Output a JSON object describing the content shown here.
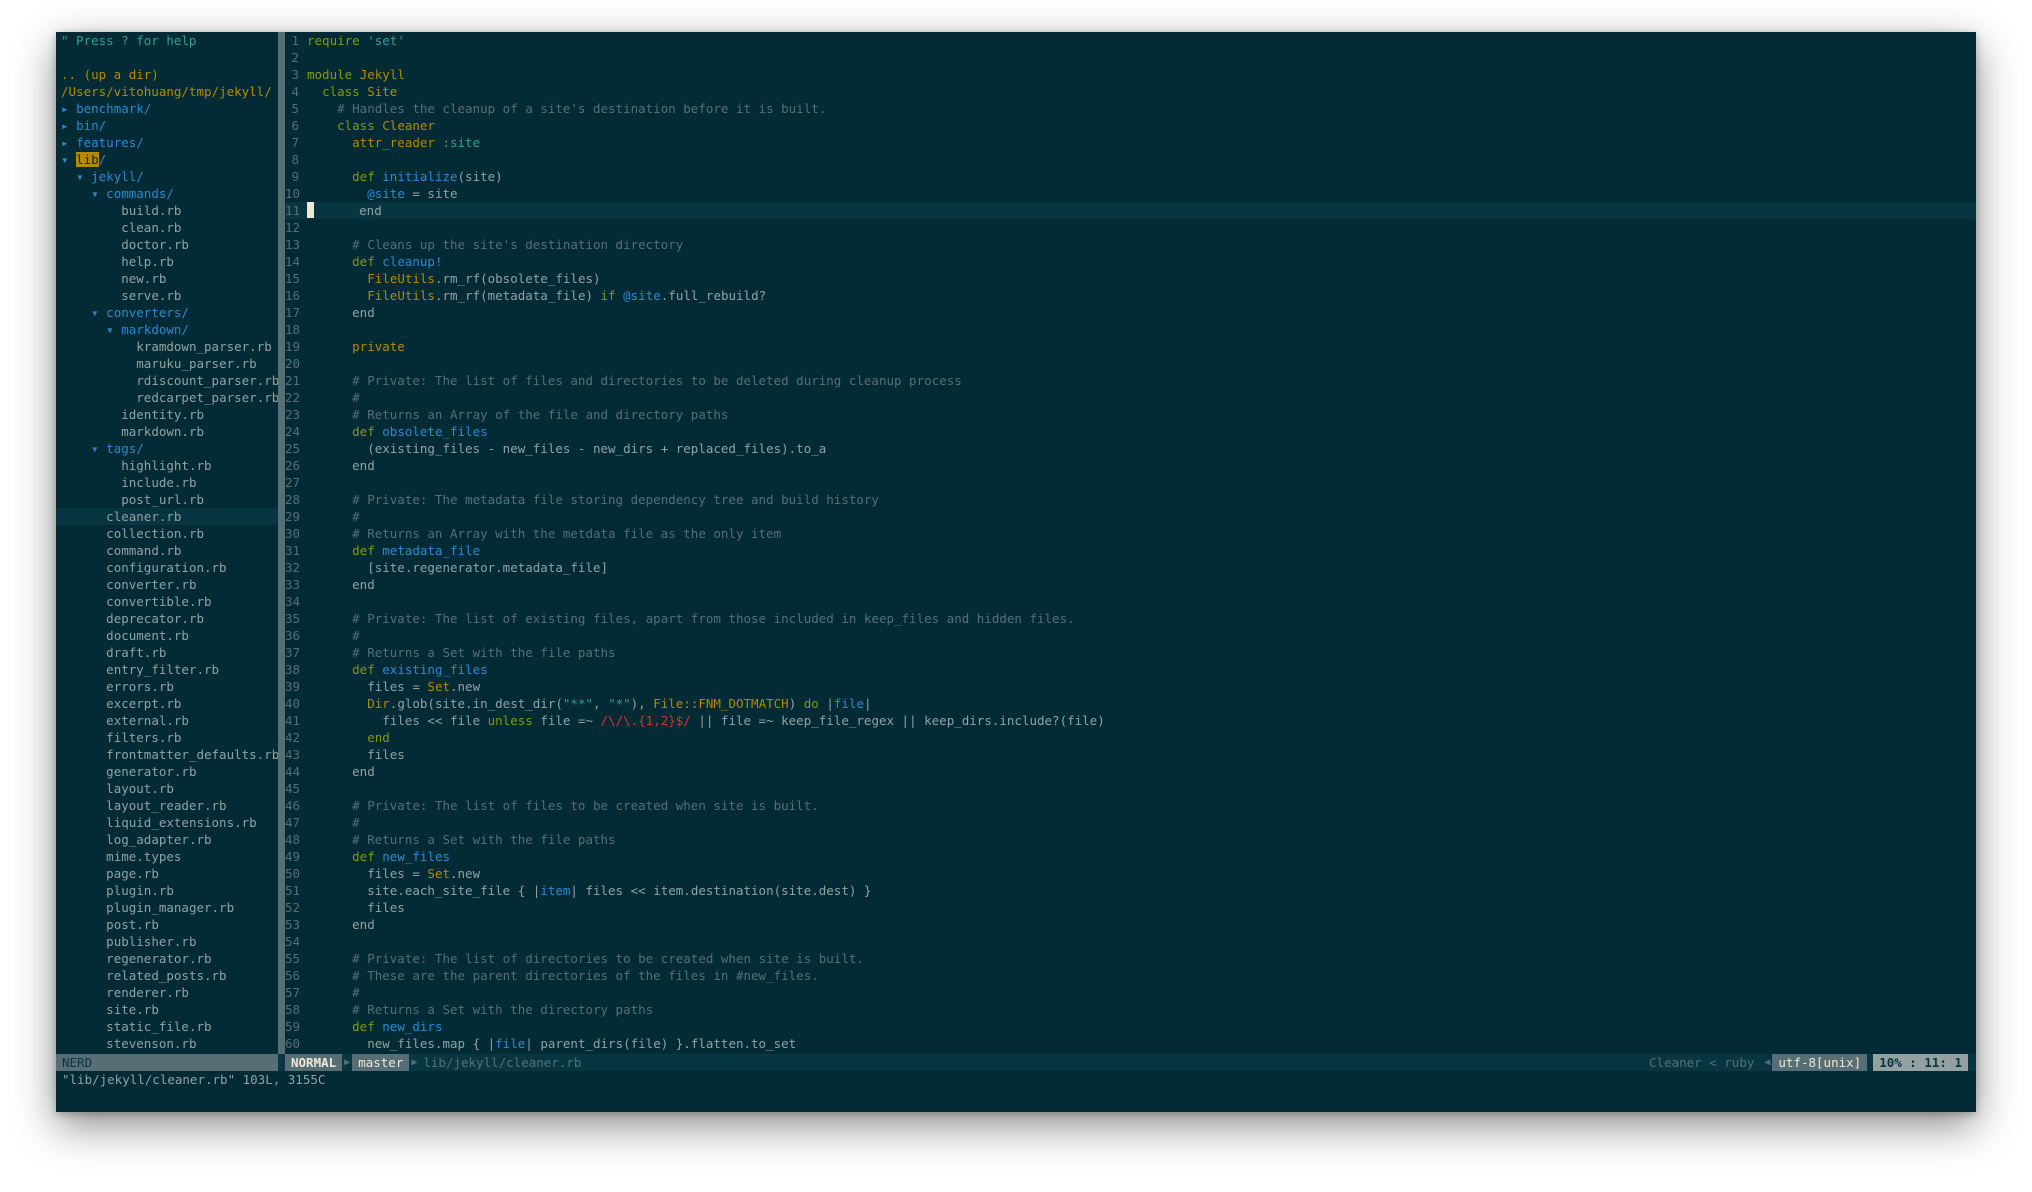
{
  "tree": {
    "help": "\" Press ? for help",
    "up": ".. (up a dir)",
    "root": "/Users/vitohuang/tmp/jekyll/",
    "entries": [
      {
        "indent": 0,
        "marker": "▸",
        "name": "benchmark/",
        "type": "dir"
      },
      {
        "indent": 0,
        "marker": "▸",
        "name": "bin/",
        "type": "dir"
      },
      {
        "indent": 0,
        "marker": "▸",
        "name": "features/",
        "type": "dir"
      },
      {
        "indent": 0,
        "marker": "▾",
        "name": "lib",
        "suffix": "/",
        "type": "dir",
        "highlight": true
      },
      {
        "indent": 1,
        "marker": "▾",
        "name": "jekyll/",
        "type": "dir"
      },
      {
        "indent": 2,
        "marker": "▾",
        "name": "commands/",
        "type": "dir"
      },
      {
        "indent": 3,
        "name": "build.rb",
        "type": "file"
      },
      {
        "indent": 3,
        "name": "clean.rb",
        "type": "file"
      },
      {
        "indent": 3,
        "name": "doctor.rb",
        "type": "file"
      },
      {
        "indent": 3,
        "name": "help.rb",
        "type": "file"
      },
      {
        "indent": 3,
        "name": "new.rb",
        "type": "file"
      },
      {
        "indent": 3,
        "name": "serve.rb",
        "type": "file"
      },
      {
        "indent": 2,
        "marker": "▾",
        "name": "converters/",
        "type": "dir"
      },
      {
        "indent": 3,
        "marker": "▾",
        "name": "markdown/",
        "type": "dir"
      },
      {
        "indent": 4,
        "name": "kramdown_parser.rb",
        "type": "file"
      },
      {
        "indent": 4,
        "name": "maruku_parser.rb",
        "type": "file"
      },
      {
        "indent": 4,
        "name": "rdiscount_parser.rb",
        "type": "file"
      },
      {
        "indent": 4,
        "name": "redcarpet_parser.rb",
        "type": "file"
      },
      {
        "indent": 3,
        "name": "identity.rb",
        "type": "file"
      },
      {
        "indent": 3,
        "name": "markdown.rb",
        "type": "file"
      },
      {
        "indent": 2,
        "marker": "▾",
        "name": "tags/",
        "type": "dir"
      },
      {
        "indent": 3,
        "name": "highlight.rb",
        "type": "file"
      },
      {
        "indent": 3,
        "name": "include.rb",
        "type": "file"
      },
      {
        "indent": 3,
        "name": "post_url.rb",
        "type": "file"
      },
      {
        "indent": 2,
        "name": "cleaner.rb",
        "type": "file",
        "current": true
      },
      {
        "indent": 2,
        "name": "collection.rb",
        "type": "file"
      },
      {
        "indent": 2,
        "name": "command.rb",
        "type": "file"
      },
      {
        "indent": 2,
        "name": "configuration.rb",
        "type": "file"
      },
      {
        "indent": 2,
        "name": "converter.rb",
        "type": "file"
      },
      {
        "indent": 2,
        "name": "convertible.rb",
        "type": "file"
      },
      {
        "indent": 2,
        "name": "deprecator.rb",
        "type": "file"
      },
      {
        "indent": 2,
        "name": "document.rb",
        "type": "file"
      },
      {
        "indent": 2,
        "name": "draft.rb",
        "type": "file"
      },
      {
        "indent": 2,
        "name": "entry_filter.rb",
        "type": "file"
      },
      {
        "indent": 2,
        "name": "errors.rb",
        "type": "file"
      },
      {
        "indent": 2,
        "name": "excerpt.rb",
        "type": "file"
      },
      {
        "indent": 2,
        "name": "external.rb",
        "type": "file"
      },
      {
        "indent": 2,
        "name": "filters.rb",
        "type": "file"
      },
      {
        "indent": 2,
        "name": "frontmatter_defaults.rb",
        "type": "file"
      },
      {
        "indent": 2,
        "name": "generator.rb",
        "type": "file"
      },
      {
        "indent": 2,
        "name": "layout.rb",
        "type": "file"
      },
      {
        "indent": 2,
        "name": "layout_reader.rb",
        "type": "file"
      },
      {
        "indent": 2,
        "name": "liquid_extensions.rb",
        "type": "file"
      },
      {
        "indent": 2,
        "name": "log_adapter.rb",
        "type": "file"
      },
      {
        "indent": 2,
        "name": "mime.types",
        "type": "file"
      },
      {
        "indent": 2,
        "name": "page.rb",
        "type": "file"
      },
      {
        "indent": 2,
        "name": "plugin.rb",
        "type": "file"
      },
      {
        "indent": 2,
        "name": "plugin_manager.rb",
        "type": "file"
      },
      {
        "indent": 2,
        "name": "post.rb",
        "type": "file"
      },
      {
        "indent": 2,
        "name": "publisher.rb",
        "type": "file"
      },
      {
        "indent": 2,
        "name": "regenerator.rb",
        "type": "file"
      },
      {
        "indent": 2,
        "name": "related_posts.rb",
        "type": "file"
      },
      {
        "indent": 2,
        "name": "renderer.rb",
        "type": "file"
      },
      {
        "indent": 2,
        "name": "site.rb",
        "type": "file"
      },
      {
        "indent": 2,
        "name": "static_file.rb",
        "type": "file"
      },
      {
        "indent": 2,
        "name": "stevenson.rb",
        "type": "file"
      }
    ]
  },
  "editor": {
    "cursor_line": 11,
    "lines": [
      [
        [
          "k",
          "require"
        ],
        [
          "p",
          " "
        ],
        [
          "s",
          "'set'"
        ]
      ],
      [],
      [
        [
          "k",
          "module"
        ],
        [
          "p",
          " "
        ],
        [
          "y",
          "Jekyll"
        ]
      ],
      [
        [
          "p",
          "  "
        ],
        [
          "k",
          "class"
        ],
        [
          "p",
          " "
        ],
        [
          "y",
          "Site"
        ]
      ],
      [
        [
          "c",
          "    # Handles the cleanup of a site's destination before it is built."
        ]
      ],
      [
        [
          "p",
          "    "
        ],
        [
          "k",
          "class"
        ],
        [
          "p",
          " "
        ],
        [
          "y",
          "Cleaner"
        ]
      ],
      [
        [
          "p",
          "      "
        ],
        [
          "y",
          "attr_reader"
        ],
        [
          "p",
          " "
        ],
        [
          "s",
          ":site"
        ]
      ],
      [],
      [
        [
          "p",
          "      "
        ],
        [
          "k",
          "def"
        ],
        [
          "p",
          " "
        ],
        [
          "f",
          "initialize"
        ],
        [
          "p",
          "(site)"
        ]
      ],
      [
        [
          "p",
          "        "
        ],
        [
          "f",
          "@site"
        ],
        [
          "p",
          " = site"
        ]
      ],
      [
        [
          "p",
          "      end"
        ]
      ],
      [],
      [
        [
          "c",
          "      # Cleans up the site's destination directory"
        ]
      ],
      [
        [
          "p",
          "      "
        ],
        [
          "k",
          "def"
        ],
        [
          "p",
          " "
        ],
        [
          "f",
          "cleanup!"
        ]
      ],
      [
        [
          "p",
          "        "
        ],
        [
          "y",
          "FileUtils"
        ],
        [
          "p",
          ".rm_rf(obsolete_files)"
        ]
      ],
      [
        [
          "p",
          "        "
        ],
        [
          "y",
          "FileUtils"
        ],
        [
          "p",
          ".rm_rf(metadata_file) "
        ],
        [
          "k",
          "if"
        ],
        [
          "p",
          " "
        ],
        [
          "f",
          "@site"
        ],
        [
          "p",
          ".full_rebuild?"
        ]
      ],
      [
        [
          "p",
          "      end"
        ]
      ],
      [],
      [
        [
          "p",
          "      "
        ],
        [
          "y",
          "private"
        ]
      ],
      [],
      [
        [
          "c",
          "      # Private: The list of files and directories to be deleted during cleanup process"
        ]
      ],
      [
        [
          "c",
          "      #"
        ]
      ],
      [
        [
          "c",
          "      # Returns an Array of the file and directory paths"
        ]
      ],
      [
        [
          "p",
          "      "
        ],
        [
          "k",
          "def"
        ],
        [
          "p",
          " "
        ],
        [
          "f",
          "obsolete_files"
        ]
      ],
      [
        [
          "p",
          "        (existing_files - new_files - new_dirs + replaced_files).to_a"
        ]
      ],
      [
        [
          "p",
          "      end"
        ]
      ],
      [],
      [
        [
          "c",
          "      # Private: The metadata file storing dependency tree and build history"
        ]
      ],
      [
        [
          "c",
          "      #"
        ]
      ],
      [
        [
          "c",
          "      # Returns an Array with the metdata file as the only item"
        ]
      ],
      [
        [
          "p",
          "      "
        ],
        [
          "k",
          "def"
        ],
        [
          "p",
          " "
        ],
        [
          "f",
          "metadata_file"
        ]
      ],
      [
        [
          "p",
          "        [site.regenerator.metadata_file]"
        ]
      ],
      [
        [
          "p",
          "      end"
        ]
      ],
      [],
      [
        [
          "c",
          "      # Private: The list of existing files, apart from those included in keep_files and hidden files."
        ]
      ],
      [
        [
          "c",
          "      #"
        ]
      ],
      [
        [
          "c",
          "      # Returns a Set with the file paths"
        ]
      ],
      [
        [
          "p",
          "      "
        ],
        [
          "k",
          "def"
        ],
        [
          "p",
          " "
        ],
        [
          "f",
          "existing_files"
        ]
      ],
      [
        [
          "p",
          "        files = "
        ],
        [
          "y",
          "Set"
        ],
        [
          "p",
          ".new"
        ]
      ],
      [
        [
          "p",
          "        "
        ],
        [
          "y",
          "Dir"
        ],
        [
          "p",
          ".glob(site.in_dest_dir("
        ],
        [
          "s",
          "\"**\""
        ],
        [
          "p",
          ", "
        ],
        [
          "s",
          "\"*\""
        ],
        [
          "p",
          "), "
        ],
        [
          "y",
          "File::FNM_DOTMATCH"
        ],
        [
          "p",
          ") "
        ],
        [
          "k",
          "do"
        ],
        [
          "p",
          " |"
        ],
        [
          "f",
          "file"
        ],
        [
          "p",
          "|"
        ]
      ],
      [
        [
          "p",
          "          files << file "
        ],
        [
          "k",
          "unless"
        ],
        [
          "p",
          " file =~ "
        ],
        [
          "r",
          "/\\/\\.{1,2}$/"
        ],
        [
          "p",
          " || file =~ keep_file_regex || keep_dirs.include?(file)"
        ]
      ],
      [
        [
          "p",
          "        "
        ],
        [
          "k",
          "end"
        ]
      ],
      [
        [
          "p",
          "        files"
        ]
      ],
      [
        [
          "p",
          "      end"
        ]
      ],
      [],
      [
        [
          "c",
          "      # Private: The list of files to be created when site is built."
        ]
      ],
      [
        [
          "c",
          "      #"
        ]
      ],
      [
        [
          "c",
          "      # Returns a Set with the file paths"
        ]
      ],
      [
        [
          "p",
          "      "
        ],
        [
          "k",
          "def"
        ],
        [
          "p",
          " "
        ],
        [
          "f",
          "new_files"
        ]
      ],
      [
        [
          "p",
          "        files = "
        ],
        [
          "y",
          "Set"
        ],
        [
          "p",
          ".new"
        ]
      ],
      [
        [
          "p",
          "        site.each_site_file { |"
        ],
        [
          "f",
          "item"
        ],
        [
          "p",
          "| files << item.destination(site.dest) }"
        ]
      ],
      [
        [
          "p",
          "        files"
        ]
      ],
      [
        [
          "p",
          "      end"
        ]
      ],
      [],
      [
        [
          "c",
          "      # Private: The list of directories to be created when site is built."
        ]
      ],
      [
        [
          "c",
          "      # These are the parent directories of the files in #new_files."
        ]
      ],
      [
        [
          "c",
          "      #"
        ]
      ],
      [
        [
          "c",
          "      # Returns a Set with the directory paths"
        ]
      ],
      [
        [
          "p",
          "      "
        ],
        [
          "k",
          "def"
        ],
        [
          "p",
          " "
        ],
        [
          "f",
          "new_dirs"
        ]
      ],
      [
        [
          "p",
          "        new_files.map { |"
        ],
        [
          "f",
          "file"
        ],
        [
          "p",
          "| parent_dirs(file) }.flatten.to_set"
        ]
      ]
    ]
  },
  "status": {
    "nerd": "NERD",
    "mode": "NORMAL",
    "separator": "▶",
    "branch": "master",
    "file": "lib/jekyll/cleaner.rb",
    "context": "Cleaner < ruby",
    "left_arrow": "◀",
    "encoding": "utf-8[unix]",
    "position": "10% :  11:  1"
  },
  "cmdline": "\"lib/jekyll/cleaner.rb\" 103L, 3155C"
}
